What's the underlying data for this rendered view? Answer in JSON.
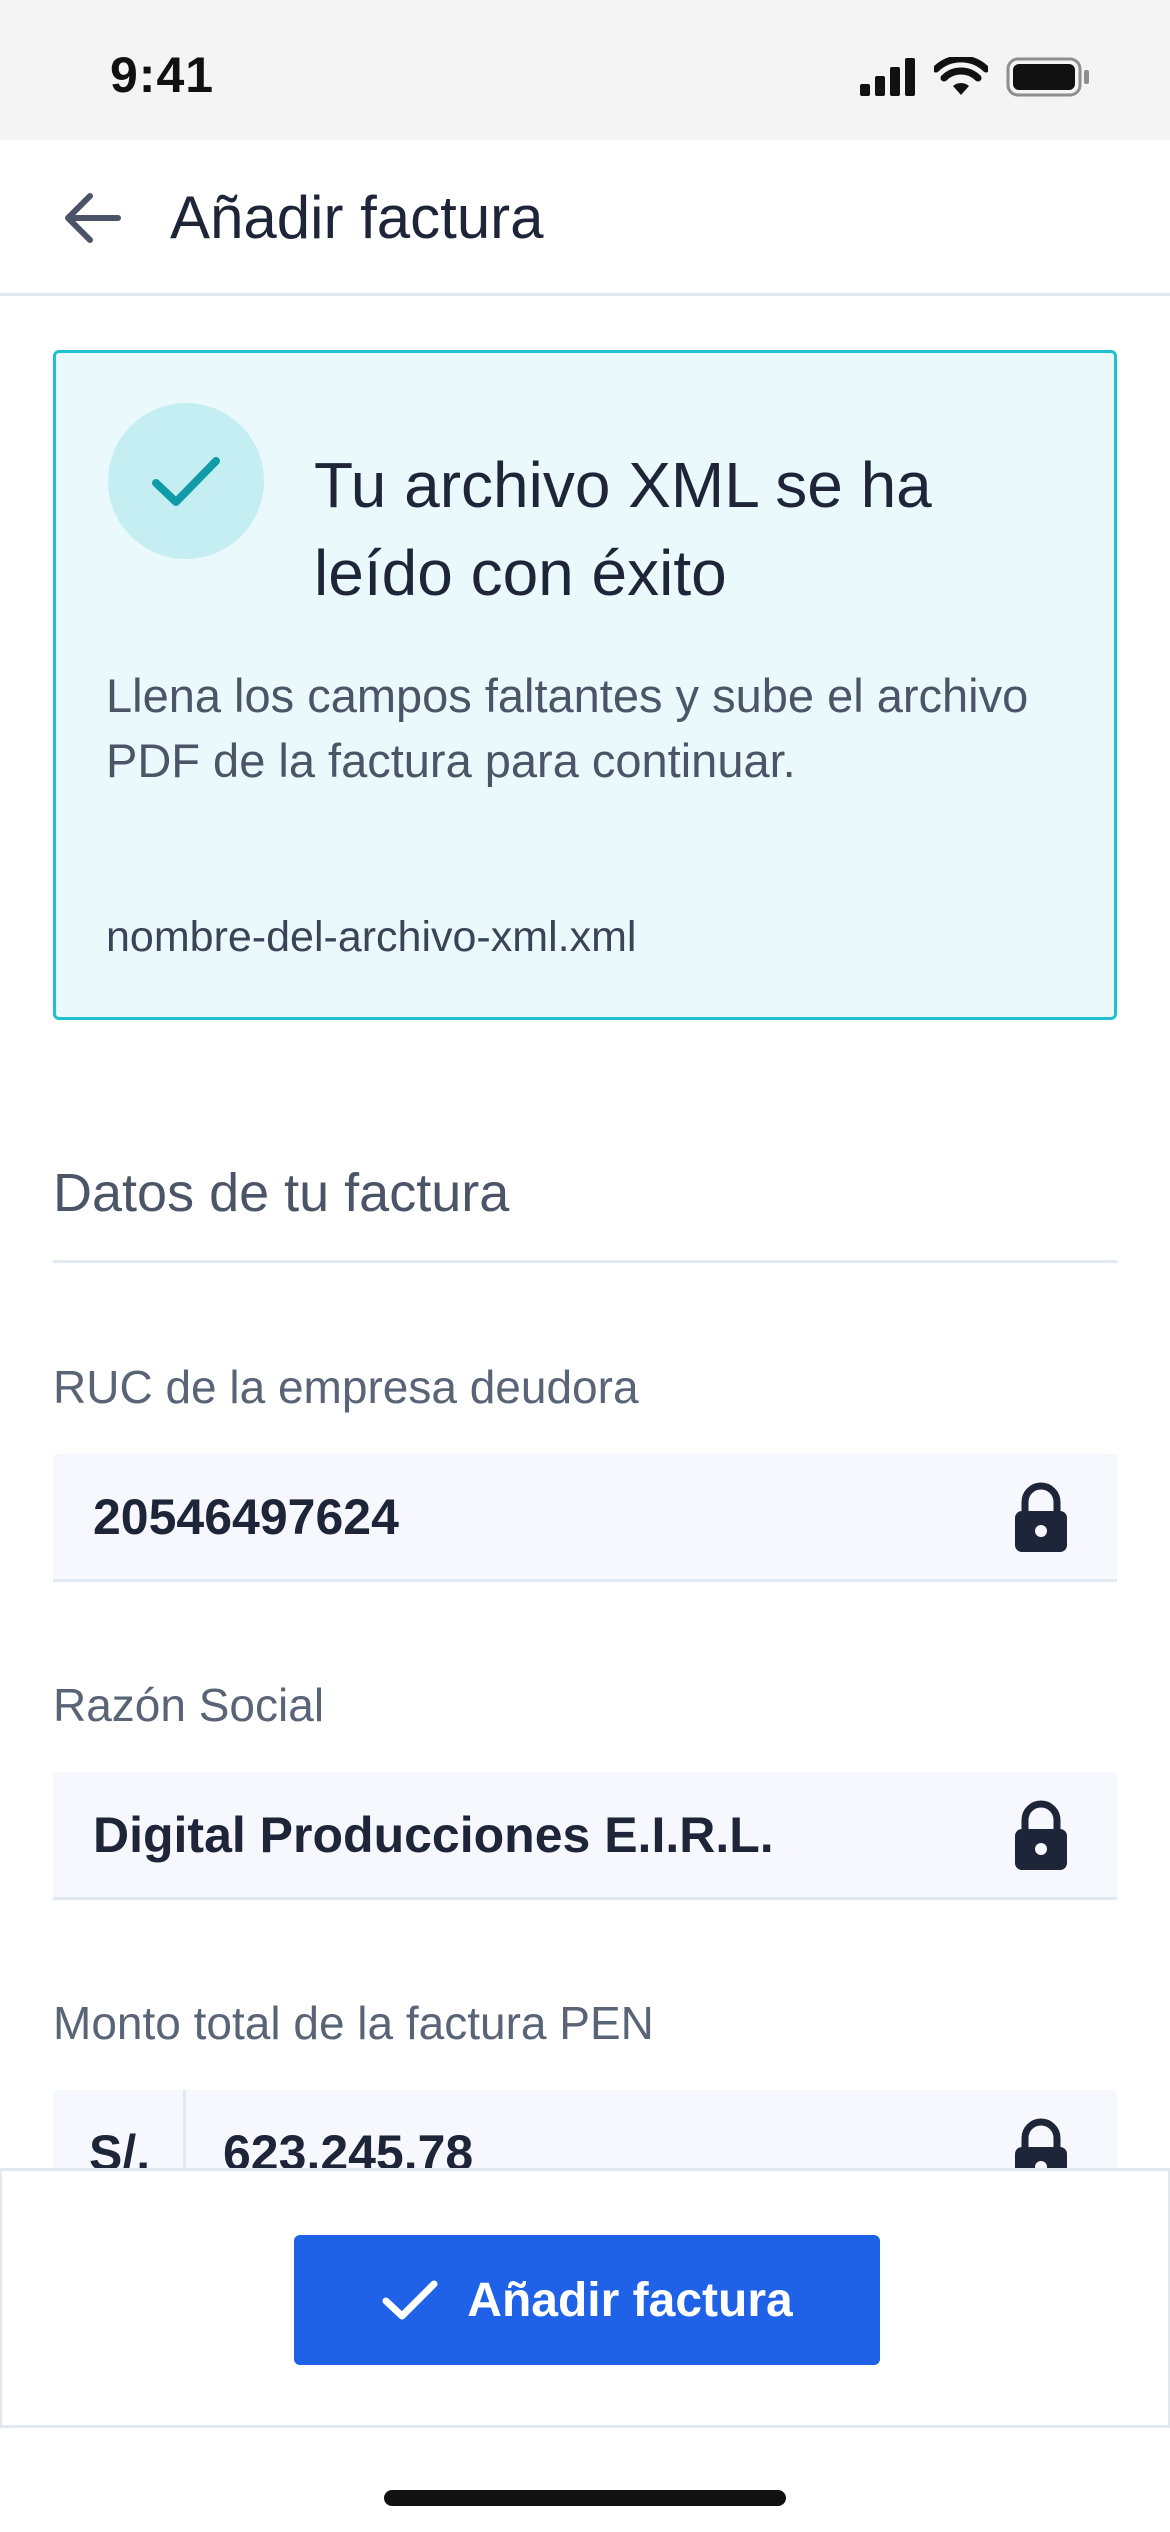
{
  "status_bar": {
    "time": "9:41"
  },
  "header": {
    "title": "Añadir factura"
  },
  "success_card": {
    "title": "Tu archivo XML se ha leído con éxito",
    "description": "Llena los campos faltantes y sube el archivo PDF de la factura para continuar.",
    "file_name": "nombre-del-archivo-xml.xml"
  },
  "section": {
    "title": "Datos de tu factura"
  },
  "fields": {
    "ruc": {
      "label": "RUC de la empresa deudora",
      "value": "20546497624"
    },
    "razon_social": {
      "label": "Razón Social",
      "value": "Digital Producciones E.I.R.L."
    },
    "monto": {
      "label": "Monto total de la factura PEN",
      "prefix": "S/.",
      "value": "623,245.78"
    }
  },
  "actions": {
    "add_label": "Añadir factura"
  },
  "colors": {
    "primary": "#1f62e8",
    "success_border": "#1ec1cf",
    "success_bg": "#e9f9fc",
    "check": "#0f9ba8"
  },
  "icons": [
    "back-arrow-icon",
    "check-icon",
    "lock-icon",
    "signal-icon",
    "wifi-icon",
    "battery-icon"
  ]
}
